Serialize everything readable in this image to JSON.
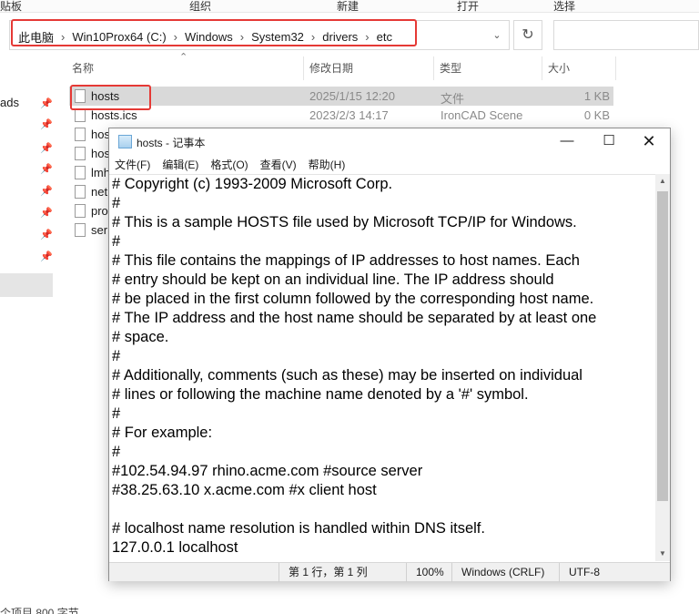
{
  "ribbon": {
    "groups": [
      "贴板",
      "组织",
      "新建",
      "打开",
      "选择"
    ]
  },
  "address_bar": {
    "crumbs": [
      "此电脑",
      "Win10Prox64 (C:)",
      "Windows",
      "System32",
      "drivers",
      "etc"
    ]
  },
  "nav": {
    "partial_label": "ads"
  },
  "file_list": {
    "columns": {
      "name": "名称",
      "modified": "修改日期",
      "type": "类型",
      "size": "大小"
    },
    "rows": [
      {
        "name": "hosts",
        "date": "2025/1/15 12:20",
        "type": "文件",
        "size": "1 KB",
        "selected": true
      },
      {
        "name": "hosts.ics",
        "date": "2023/2/3 14:17",
        "type": "IronCAD Scene",
        "size": "0 KB"
      },
      {
        "name": "hos",
        "date": "",
        "type": "",
        "size": ""
      },
      {
        "name": "hos",
        "date": "",
        "type": "",
        "size": ""
      },
      {
        "name": "lmh",
        "date": "",
        "type": "",
        "size": ""
      },
      {
        "name": "net",
        "date": "",
        "type": "",
        "size": ""
      },
      {
        "name": "pro",
        "date": "",
        "type": "",
        "size": ""
      },
      {
        "name": "ser",
        "date": "",
        "type": "",
        "size": ""
      }
    ]
  },
  "explorer_status": {
    "text": "个项目  800 字节"
  },
  "notepad": {
    "title": "hosts - 记事本",
    "menu": [
      "文件(F)",
      "编辑(E)",
      "格式(O)",
      "查看(V)",
      "帮助(H)"
    ],
    "lines": [
      "# Copyright (c) 1993-2009 Microsoft Corp.",
      "#",
      "# This is a sample HOSTS file used by Microsoft TCP/IP for Windows.",
      "#",
      "# This file contains the mappings of IP addresses to host names. Each",
      "# entry should be kept on an individual line. The IP address should",
      "# be placed in the first column followed by the corresponding host name.",
      "# The IP address and the host name should be separated by at least one",
      "# space.",
      "#",
      "# Additionally, comments (such as these) may be inserted on individual",
      "# lines or following the machine name denoted by a '#' symbol.",
      "#",
      "# For example:",
      "#",
      "#102.54.94.97 rhino.acme.com #source server",
      "#38.25.63.10 x.acme.com #x client host",
      "",
      "# localhost name resolution is handled within DNS itself.",
      "127.0.0.1 localhost"
    ],
    "status": {
      "position": "第 1 行，第 1 列",
      "zoom": "100%",
      "line_ending": "Windows (CRLF)",
      "encoding": "UTF-8"
    }
  },
  "colors": {
    "highlight_border": "#e53935",
    "selected_row": "#d9d9d9"
  }
}
